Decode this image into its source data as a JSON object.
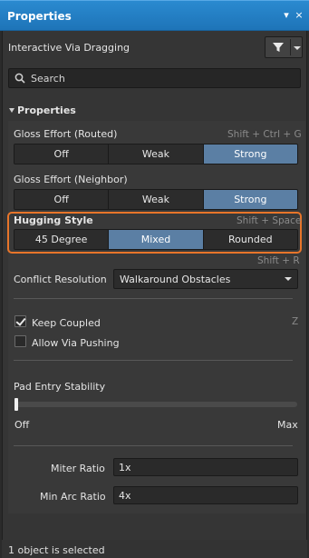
{
  "window": {
    "title": "Properties",
    "pin_glyph": "▾",
    "close_glyph": "×"
  },
  "header": {
    "mode_label": "Interactive Via Dragging",
    "filter_icon": "filter-icon"
  },
  "search": {
    "placeholder": "Search"
  },
  "section": {
    "title": "Properties"
  },
  "gloss_routed": {
    "label": "Gloss Effort (Routed)",
    "shortcut": "Shift + Ctrl + G",
    "options": [
      "Off",
      "Weak",
      "Strong"
    ],
    "selected": "Strong"
  },
  "gloss_neighbor": {
    "label": "Gloss Effort (Neighbor)",
    "options": [
      "Off",
      "Weak",
      "Strong"
    ],
    "selected": "Strong"
  },
  "hugging": {
    "label": "Hugging Style",
    "shortcut": "Shift + Space",
    "options": [
      "45 Degree",
      "Mixed",
      "Rounded"
    ],
    "selected": "Mixed"
  },
  "conflict": {
    "shortcut": "Shift + R",
    "label": "Conflict Resolution",
    "value": "Walkaround Obstacles"
  },
  "keep_coupled": {
    "label": "Keep Coupled",
    "checked": true,
    "shortcut": "Z"
  },
  "allow_via_pushing": {
    "label": "Allow Via Pushing",
    "checked": false
  },
  "pad_entry": {
    "label": "Pad Entry Stability",
    "min_label": "Off",
    "max_label": "Max",
    "level": 0
  },
  "miter": {
    "label": "Miter Ratio",
    "value": "1x"
  },
  "min_arc": {
    "label": "Min Arc Ratio",
    "value": "4x"
  },
  "status": {
    "text": "1 object is selected"
  },
  "colors": {
    "accent": "#5b7fa4",
    "titlebar": "#2280c4",
    "highlight": "#e8752a"
  }
}
